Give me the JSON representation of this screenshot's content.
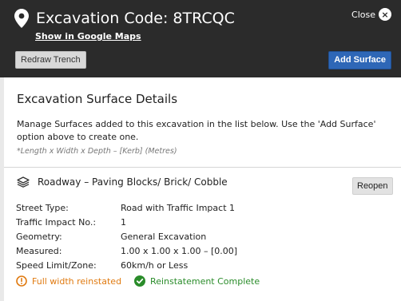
{
  "header": {
    "title": "Excavation Code: 8TRCQC",
    "maps_link": "Show in Google Maps",
    "close_label": "Close",
    "close_icon": "×",
    "redraw_label": "Redraw Trench",
    "add_surface_label": "Add Surface"
  },
  "section": {
    "title": "Excavation Surface Details",
    "description": "Manage Surfaces added to this excavation in the list below. Use the 'Add Surface' option above to create one.",
    "note": "*Length x Width x Depth – [Kerb] (Metres)"
  },
  "surface": {
    "name": "Roadway – Paving Blocks/ Brick/ Cobble",
    "reopen_label": "Reopen",
    "details": [
      {
        "label": "Street Type:",
        "value": "Road with Traffic Impact 1"
      },
      {
        "label": "Traffic Impact No.:",
        "value": "1"
      },
      {
        "label": "Geometry:",
        "value": "General Excavation"
      },
      {
        "label": "Measured:",
        "value": "1.00 x 1.00 x 1.00 – [0.00]"
      },
      {
        "label": "Speed Limit/Zone:",
        "value": "60km/h or Less"
      }
    ],
    "statuses": [
      {
        "text": "Full width reinstated",
        "icon": "warning-circle-icon",
        "color": "#e07a10"
      },
      {
        "text": "Reinstatement Complete",
        "icon": "check-circle-icon",
        "color": "#2a8c2a"
      }
    ]
  },
  "colors": {
    "header_bg": "#2b2b2b",
    "accent": "#2e67b7"
  }
}
